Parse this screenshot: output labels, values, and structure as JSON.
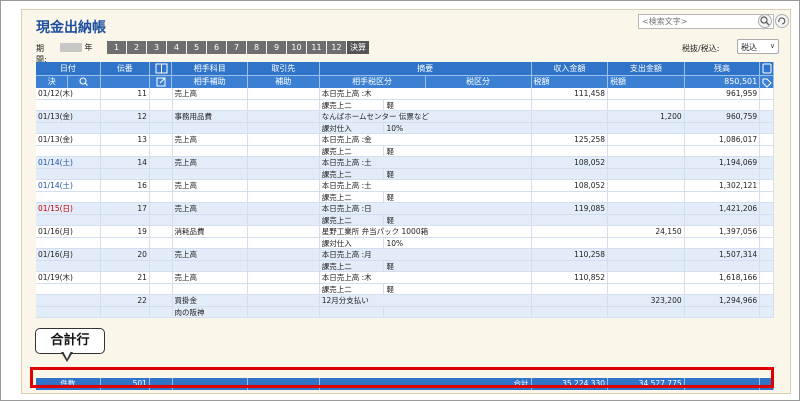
{
  "title": "現金出納帳",
  "search": {
    "placeholder": "<検索文字>"
  },
  "period": {
    "label": "期間:",
    "year_suffix": "年",
    "months": [
      "1",
      "2",
      "3",
      "4",
      "5",
      "6",
      "7",
      "8",
      "9",
      "10",
      "11",
      "12"
    ],
    "kessan": "決算"
  },
  "tax": {
    "label": "税抜/税込:",
    "selected": "税込"
  },
  "header": {
    "date": "日付",
    "kessan": "決",
    "denpyo": "伝番",
    "account": "相手科目",
    "account_sub": "相手補助",
    "partner": "取引先",
    "partner_sub": "補助",
    "description": "摘要",
    "tax_class": "相手税区分",
    "tax_class2": "税区分",
    "income": "収入金額",
    "income_tax": "税額",
    "expense": "支出金額",
    "expense_tax": "税額",
    "balance": "残高",
    "balance_value": "850,501"
  },
  "rows": [
    {
      "date": "01/12(木)",
      "day": "normal",
      "den": "11",
      "acc": "売上高",
      "sub": "",
      "desc": "本日売上高 :木",
      "tax": "課売上二",
      "tax2": "軽",
      "inc": "111,458",
      "exp": "",
      "bal": "961,959"
    },
    {
      "date": "01/13(金)",
      "day": "normal",
      "den": "12",
      "acc": "事務用品費",
      "sub": "",
      "desc": "なんばホームセンター 伝票など",
      "tax": "課対仕入",
      "tax2": "10%",
      "inc": "",
      "exp": "1,200",
      "bal": "960,759"
    },
    {
      "date": "01/13(金)",
      "day": "normal",
      "den": "13",
      "acc": "売上高",
      "sub": "",
      "desc": "本日売上高 :金",
      "tax": "課売上二",
      "tax2": "軽",
      "inc": "125,258",
      "exp": "",
      "bal": "1,086,017"
    },
    {
      "date": "01/14(土)",
      "day": "sat",
      "den": "14",
      "acc": "売上高",
      "sub": "",
      "desc": "本日売上高 :土",
      "tax": "課売上二",
      "tax2": "軽",
      "inc": "108,052",
      "exp": "",
      "bal": "1,194,069"
    },
    {
      "date": "01/14(土)",
      "day": "sat",
      "den": "16",
      "acc": "売上高",
      "sub": "",
      "desc": "本日売上高 :土",
      "tax": "課売上二",
      "tax2": "軽",
      "inc": "108,052",
      "exp": "",
      "bal": "1,302,121"
    },
    {
      "date": "01/15(日)",
      "day": "sun",
      "den": "17",
      "acc": "売上高",
      "sub": "",
      "desc": "本日売上高 :日",
      "tax": "課売上二",
      "tax2": "軽",
      "inc": "119,085",
      "exp": "",
      "bal": "1,421,206"
    },
    {
      "date": "01/16(月)",
      "day": "normal",
      "den": "19",
      "acc": "消耗品費",
      "sub": "",
      "desc": "星野工業所 弁当パック 1000箱",
      "tax": "課対仕入",
      "tax2": "10%",
      "inc": "",
      "exp": "24,150",
      "bal": "1,397,056"
    },
    {
      "date": "01/16(月)",
      "day": "normal",
      "den": "20",
      "acc": "売上高",
      "sub": "",
      "desc": "本日売上高 :月",
      "tax": "課売上二",
      "tax2": "軽",
      "inc": "110,258",
      "exp": "",
      "bal": "1,507,314"
    },
    {
      "date": "01/19(木)",
      "day": "normal",
      "den": "21",
      "acc": "売上高",
      "sub": "",
      "desc": "本日売上高 :木",
      "tax": "課売上二",
      "tax2": "軽",
      "inc": "110,852",
      "exp": "",
      "bal": "1,618,166"
    },
    {
      "date": "",
      "day": "normal",
      "den": "22",
      "acc": "買掛金",
      "sub": "肉の阪神",
      "desc": "12月分支払い",
      "tax": "",
      "tax2": "",
      "inc": "",
      "exp": "323,200",
      "bal": "1,294,966"
    }
  ],
  "total": {
    "count_label": "件数",
    "count": "501",
    "sum_label": "合計",
    "income": "35,224,330",
    "expense": "34,527,775"
  },
  "callout": "合計行"
}
